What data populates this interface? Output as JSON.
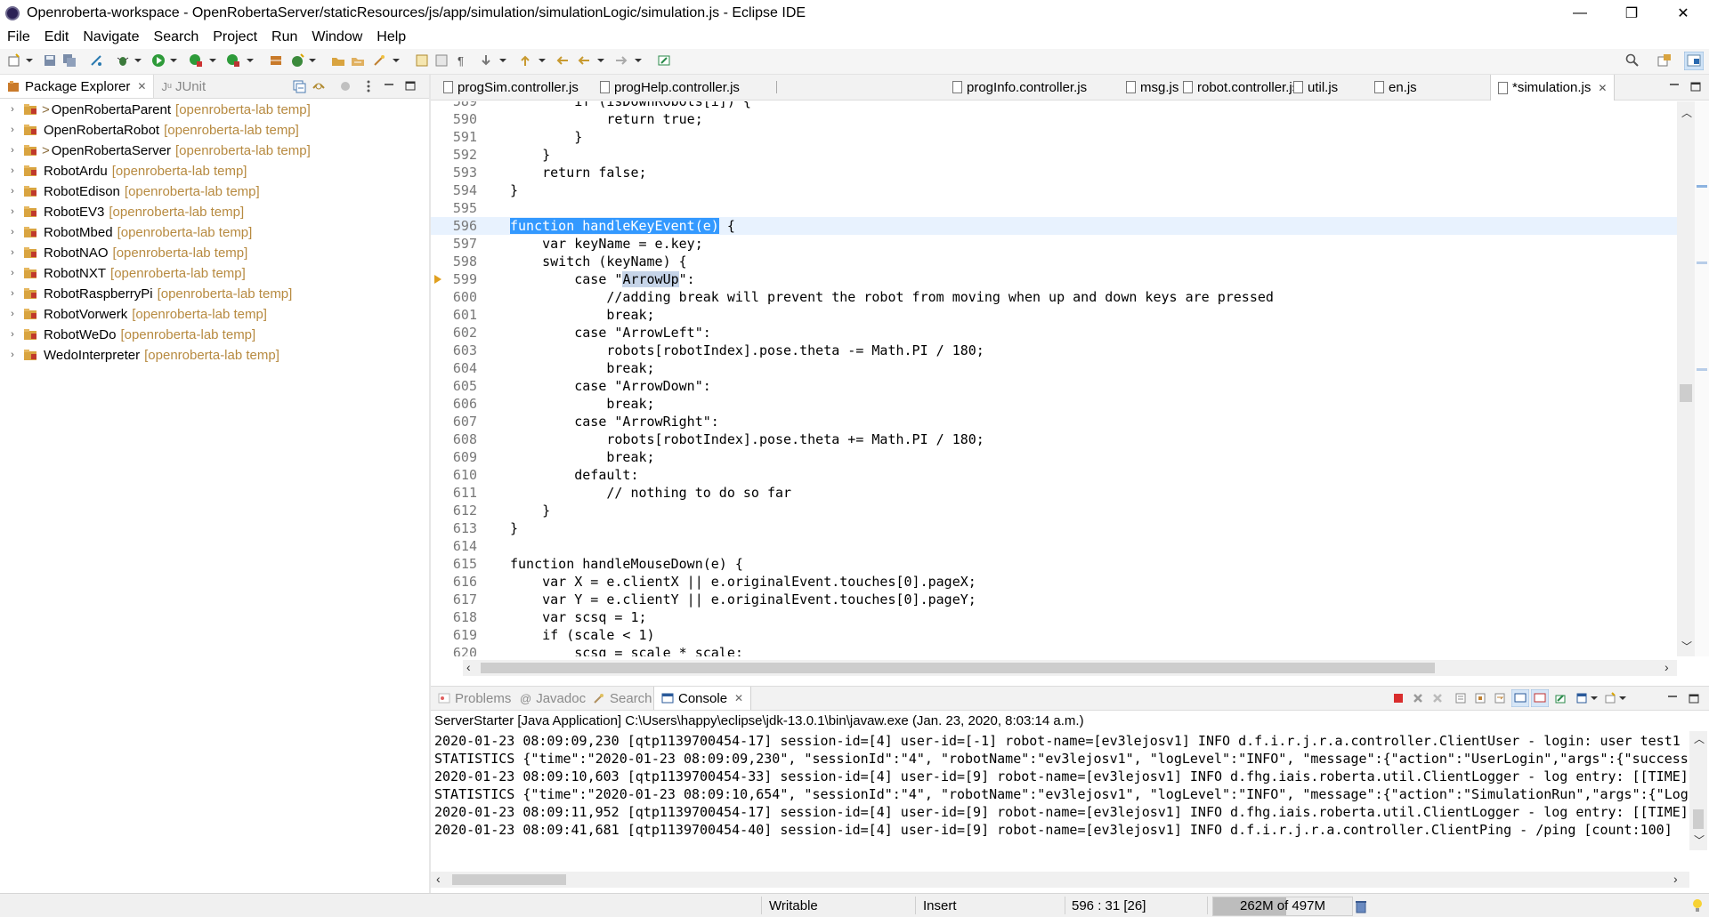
{
  "window": {
    "title": "Openroberta-workspace - OpenRobertaServer/staticResources/js/app/simulation/simulationLogic/simulation.js - Eclipse IDE",
    "minimize": "—",
    "maximize": "❐",
    "close": "✕"
  },
  "menu": [
    "File",
    "Edit",
    "Navigate",
    "Search",
    "Project",
    "Run",
    "Window",
    "Help"
  ],
  "left_panel": {
    "tabs": [
      {
        "label": "Package Explorer",
        "close": "✕"
      },
      {
        "label": "JUnit",
        "prefix": "Jᵘ"
      }
    ],
    "projects": [
      {
        "prefix": ">",
        "name": "OpenRobertaParent",
        "decor": "[openroberta-lab temp]"
      },
      {
        "prefix": "",
        "name": "OpenRobertaRobot",
        "decor": "[openroberta-lab temp]"
      },
      {
        "prefix": ">",
        "name": "OpenRobertaServer",
        "decor": "[openroberta-lab temp]"
      },
      {
        "prefix": "",
        "name": "RobotArdu",
        "decor": "[openroberta-lab temp]"
      },
      {
        "prefix": "",
        "name": "RobotEdison",
        "decor": "[openroberta-lab temp]"
      },
      {
        "prefix": "",
        "name": "RobotEV3",
        "decor": "[openroberta-lab temp]"
      },
      {
        "prefix": "",
        "name": "RobotMbed",
        "decor": "[openroberta-lab temp]"
      },
      {
        "prefix": "",
        "name": "RobotNAO",
        "decor": "[openroberta-lab temp]"
      },
      {
        "prefix": "",
        "name": "RobotNXT",
        "decor": "[openroberta-lab temp]"
      },
      {
        "prefix": "",
        "name": "RobotRaspberryPi",
        "decor": "[openroberta-lab temp]"
      },
      {
        "prefix": "",
        "name": "RobotVorwerk",
        "decor": "[openroberta-lab temp]"
      },
      {
        "prefix": "",
        "name": "RobotWeDo",
        "decor": "[openroberta-lab temp]"
      },
      {
        "prefix": "",
        "name": "WedoInterpreter",
        "decor": "[openroberta-lab temp]"
      }
    ]
  },
  "editor": {
    "tabs": [
      {
        "label": "progSim.controller.js",
        "active": false
      },
      {
        "label": "progHelp.controller.js",
        "active": false
      },
      {
        "label": "progInfo.controller.js",
        "active": false
      },
      {
        "label": "msg.js",
        "active": false
      },
      {
        "label": "robot.controller.js",
        "active": false
      },
      {
        "label": "util.js",
        "active": false
      },
      {
        "label": "en.js",
        "active": false
      },
      {
        "label": "*simulation.js",
        "active": true
      }
    ],
    "lines": [
      {
        "n": "589",
        "t": "        if (isDownRobots[i]) {"
      },
      {
        "n": "590",
        "t": "            return true;"
      },
      {
        "n": "591",
        "t": "        }"
      },
      {
        "n": "592",
        "t": "    }"
      },
      {
        "n": "593",
        "t": "    return false;"
      },
      {
        "n": "594",
        "t": "}"
      },
      {
        "n": "595",
        "t": ""
      },
      {
        "n": "596",
        "t": "function handleKeyEvent(e) {"
      },
      {
        "n": "597",
        "t": "    var keyName = e.key;"
      },
      {
        "n": "598",
        "t": "    switch (keyName) {"
      },
      {
        "n": "599",
        "t": "        case \"ArrowUp\":"
      },
      {
        "n": "600",
        "t": "            //adding break will prevent the robot from moving when up and down keys are pressed"
      },
      {
        "n": "601",
        "t": "            break;"
      },
      {
        "n": "602",
        "t": "        case \"ArrowLeft\":"
      },
      {
        "n": "603",
        "t": "            robots[robotIndex].pose.theta -= Math.PI / 180;"
      },
      {
        "n": "604",
        "t": "            break;"
      },
      {
        "n": "605",
        "t": "        case \"ArrowDown\":"
      },
      {
        "n": "606",
        "t": "            break;"
      },
      {
        "n": "607",
        "t": "        case \"ArrowRight\":"
      },
      {
        "n": "608",
        "t": "            robots[robotIndex].pose.theta += Math.PI / 180;"
      },
      {
        "n": "609",
        "t": "            break;"
      },
      {
        "n": "610",
        "t": "        default:"
      },
      {
        "n": "611",
        "t": "            // nothing to do so far"
      },
      {
        "n": "612",
        "t": "    }"
      },
      {
        "n": "613",
        "t": "}"
      },
      {
        "n": "614",
        "t": ""
      },
      {
        "n": "615",
        "t": "function handleMouseDown(e) {"
      },
      {
        "n": "616",
        "t": "    var X = e.clientX || e.originalEvent.touches[0].pageX;"
      },
      {
        "n": "617",
        "t": "    var Y = e.clientY || e.originalEvent.touches[0].pageY;"
      },
      {
        "n": "618",
        "t": "    var scsq = 1;"
      },
      {
        "n": "619",
        "t": "    if (scale < 1)"
      },
      {
        "n": "620",
        "t": "        scsq = scale * scale;"
      }
    ],
    "selected_text": "function handleKeyEvent(e)",
    "highlight_word": "ArrowUp"
  },
  "console": {
    "tabs": [
      {
        "label": "Problems",
        "active": false
      },
      {
        "label": "Javadoc",
        "active": false
      },
      {
        "label": "Search",
        "active": false
      },
      {
        "label": "Console",
        "active": true
      }
    ],
    "header": "ServerStarter [Java Application] C:\\Users\\happy\\eclipse\\jdk-13.0.1\\bin\\javaw.exe (Jan. 23, 2020, 8:03:14 a.m.)",
    "lines": [
      "2020-01-23 08:09:09,230 [qtp1139700454-17] session-id=[4] user-id=[-1] robot-name=[ev3lejosv1] INFO d.f.i.r.j.r.a.controller.ClientUser - login: user test1",
      "STATISTICS {\"time\":\"2020-01-23 08:09:09,230\", \"sessionId\":\"4\", \"robotName\":\"ev3lejosv1\", \"logLevel\":\"INFO\", \"message\":{\"action\":\"UserLogin\",\"args\":{\"success",
      "2020-01-23 08:09:10,603 [qtp1139700454-33] session-id=[4] user-id=[9] robot-name=[ev3lejosv1] INFO d.fhg.iais.roberta.util.ClientLogger - log entry: [[TIME]",
      "STATISTICS {\"time\":\"2020-01-23 08:09:10,654\", \"sessionId\":\"4\", \"robotName\":\"ev3lejosv1\", \"logLevel\":\"INFO\", \"message\":{\"action\":\"SimulationRun\",\"args\":{\"Log",
      "2020-01-23 08:09:11,952 [qtp1139700454-17] session-id=[4] user-id=[9] robot-name=[ev3lejosv1] INFO d.fhg.iais.roberta.util.ClientLogger - log entry: [[TIME]",
      "2020-01-23 08:09:41,681 [qtp1139700454-40] session-id=[4] user-id=[9] robot-name=[ev3lejosv1] INFO d.f.i.r.j.r.a.controller.ClientPing - /ping [count:100]"
    ]
  },
  "status": {
    "writable": "Writable",
    "insert": "Insert",
    "position": "596 : 31 [26]",
    "memory": "262M of 497M",
    "memory_used_fraction": 0.527
  },
  "colors": {
    "selection": "#3399ff",
    "current_line": "#e8f2fe",
    "decoration": "#b78a40",
    "line_number": "#787878"
  }
}
